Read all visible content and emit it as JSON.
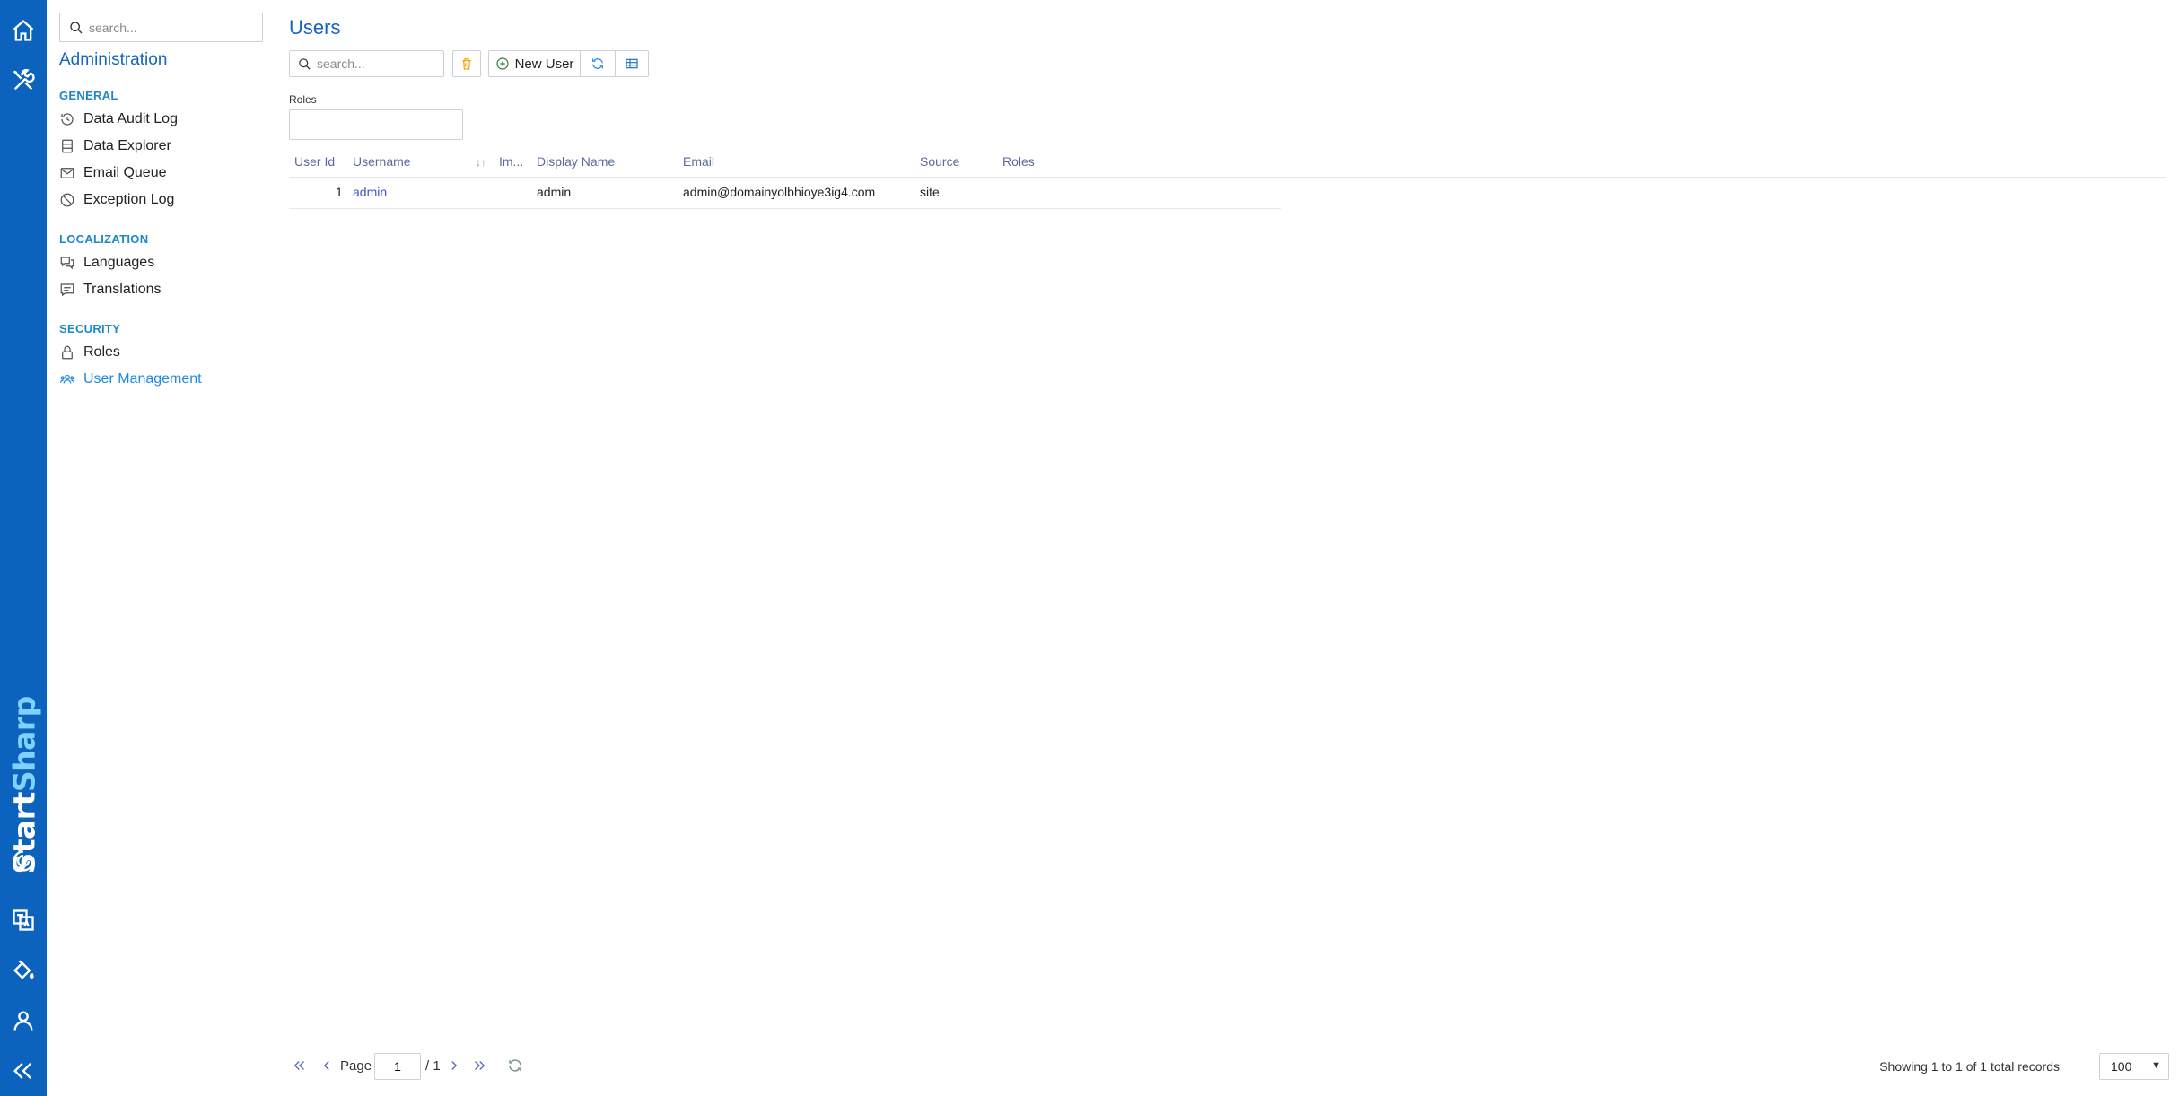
{
  "rail": {
    "top_icons": [
      "home-icon",
      "tools-icon"
    ],
    "brand": {
      "part1": "Start",
      "part2": "Sharp"
    },
    "bottom_icons": [
      "translate-icon",
      "paint-bucket-icon",
      "user-icon",
      "collapse-icon"
    ]
  },
  "sidenav": {
    "search_placeholder": "search...",
    "title": "Administration",
    "groups": [
      {
        "label": "GENERAL",
        "items": [
          {
            "label": "Data Audit Log",
            "icon": "history-icon"
          },
          {
            "label": "Data Explorer",
            "icon": "database-icon"
          },
          {
            "label": "Email Queue",
            "icon": "envelope-icon"
          },
          {
            "label": "Exception Log",
            "icon": "ban-icon"
          }
        ]
      },
      {
        "label": "LOCALIZATION",
        "items": [
          {
            "label": "Languages",
            "icon": "comments-icon"
          },
          {
            "label": "Translations",
            "icon": "comment-text-icon"
          }
        ]
      },
      {
        "label": "SECURITY",
        "items": [
          {
            "label": "Roles",
            "icon": "lock-icon"
          },
          {
            "label": "User Management",
            "icon": "users-icon",
            "active": true
          }
        ]
      }
    ]
  },
  "main": {
    "title": "Users",
    "search_placeholder": "search...",
    "new_user_label": "New User",
    "roles_filter_label": "Roles",
    "columns": [
      "User Id",
      "Username",
      "Im...",
      "Display Name",
      "Email",
      "Source",
      "Roles"
    ],
    "rows": [
      {
        "user_id": "1",
        "username": "admin",
        "image": "",
        "display_name": "admin",
        "email": "admin@domainyolbhioye3ig4.com",
        "source": "site",
        "roles": ""
      }
    ]
  },
  "pager": {
    "page_label": "Page",
    "current_page": "1",
    "total_pages": "/ 1",
    "status": "Showing 1 to 1 of 1 total records",
    "page_size": "100"
  },
  "colors": {
    "rail": "#0c63bd",
    "accent": "#1565c0",
    "active": "#1e88e5"
  }
}
